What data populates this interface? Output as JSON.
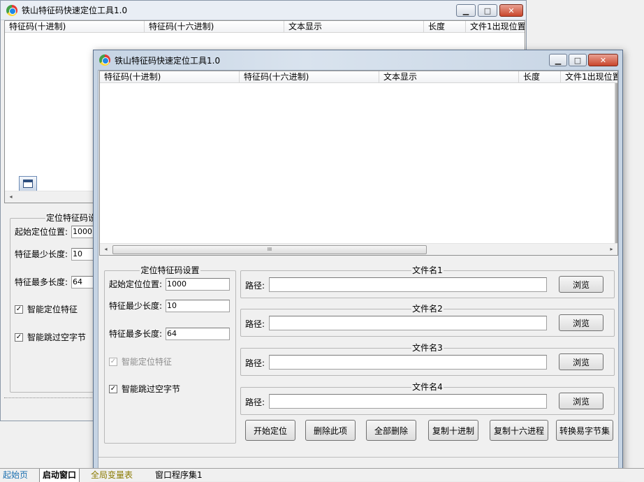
{
  "back_window": {
    "title": "铁山特征码快速定位工具1.0",
    "columns": [
      "特征码(十进制)",
      "特征码(十六进制)",
      "文本显示",
      "长度",
      "文件1出现位置"
    ],
    "group_title": "定位特征码设",
    "start_label": "起始定位位置:",
    "start_value": "1000",
    "min_label": "特征最少长度:",
    "min_value": "10",
    "max_label": "特征最多长度:",
    "max_value": "64",
    "smart_locate": "智能定位特征",
    "skip_empty": "智能跳过空字节"
  },
  "front_window": {
    "title": "铁山特征码快速定位工具1.0",
    "columns": [
      "特征码(十进制)",
      "特征码(十六进制)",
      "文本显示",
      "长度",
      "文件1出现位置"
    ],
    "scroll_grip": "III",
    "settings": {
      "title": "定位特征码设置",
      "start_label": "起始定位位置:",
      "start_value": "1000",
      "min_label": "特征最少长度:",
      "min_value": "10",
      "max_label": "特征最多长度:",
      "max_value": "64",
      "smart_locate": "智能定位特征",
      "skip_empty": "智能跳过空字节"
    },
    "files": [
      {
        "title": "文件名1",
        "path_label": "路径:",
        "path": "",
        "browse": "浏览"
      },
      {
        "title": "文件名2",
        "path_label": "路径:",
        "path": "",
        "browse": "浏览"
      },
      {
        "title": "文件名3",
        "path_label": "路径:",
        "path": "",
        "browse": "浏览"
      },
      {
        "title": "文件名4",
        "path_label": "路径:",
        "path": "",
        "browse": "浏览"
      }
    ],
    "buttons": [
      "开始定位",
      "删除此项",
      "全部删除",
      "复制十进制",
      "复制十六进程",
      "转换易字节集"
    ]
  },
  "tabs": [
    "起始页",
    "启动窗口",
    "全局变量表",
    "窗口程序集1"
  ],
  "checkmark": "✓"
}
